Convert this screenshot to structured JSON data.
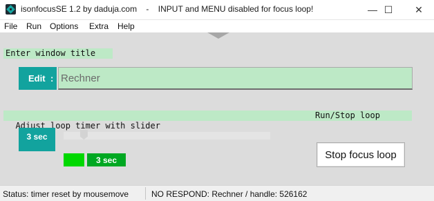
{
  "window": {
    "title": "isonfocusSE 1.2 by daduja.com    -    INPUT and MENU disabled for focus loop!",
    "minimize_glyph": "—",
    "maximize_glyph": "☐",
    "close_glyph": "✕"
  },
  "menu": {
    "items": [
      "File",
      "Run",
      "Options",
      "Extra",
      "Help"
    ]
  },
  "sections": {
    "window_title_label": "Enter window title",
    "slider_label": "Adjust loop timer with slider",
    "runstop_label": "Run/Stop loop"
  },
  "edit": {
    "label": "Edit",
    "colon": ":",
    "value": "Rechner"
  },
  "timer": {
    "badge": "3 sec",
    "display": "3 sec",
    "slider_fraction": 0.083
  },
  "buttons": {
    "stop": "Stop focus loop"
  },
  "status": {
    "left": "Status: timer reset by mousemove",
    "right": "NO RESPOND: Rechner / handle: 526162"
  },
  "colors": {
    "teal": "#12a39e",
    "mint": "#bde9c6",
    "green_bright": "#00d800",
    "green_dark": "#00a822"
  }
}
